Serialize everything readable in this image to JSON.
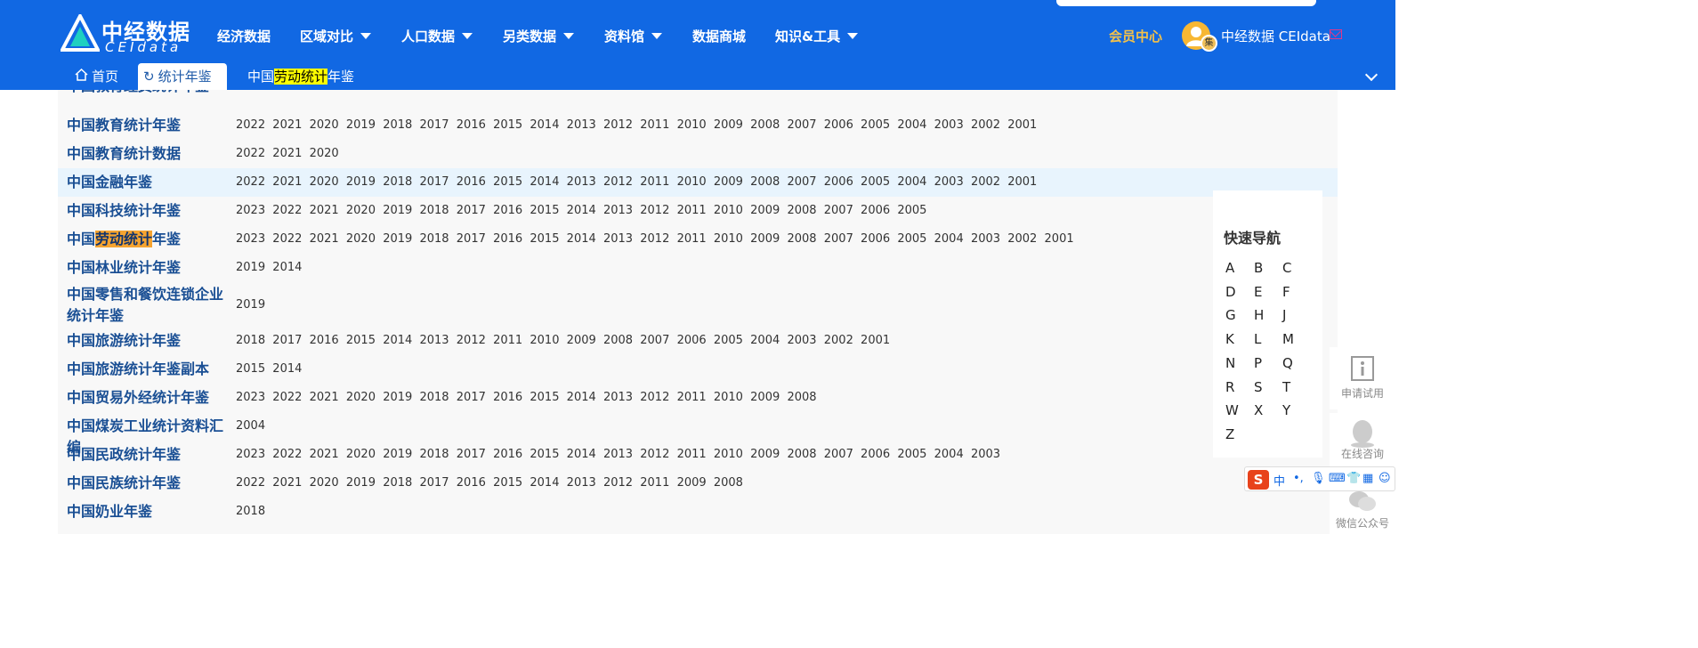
{
  "logo": {
    "cn": "中经数据",
    "en": "CEIdata"
  },
  "nav": [
    {
      "label": "经济数据",
      "dropdown": false
    },
    {
      "label": "区域对比",
      "dropdown": true
    },
    {
      "label": "人口数据",
      "dropdown": true
    },
    {
      "label": "另类数据",
      "dropdown": true
    },
    {
      "label": "资料馆",
      "dropdown": true
    },
    {
      "label": "数据商城",
      "dropdown": false
    },
    {
      "label": "知识&工具",
      "dropdown": true
    }
  ],
  "header": {
    "member_center": "会员中心",
    "avatar_badge": "集",
    "username": "中经数据 CEIdata"
  },
  "tabs": {
    "home": "首页",
    "yearbook": "统计年鉴",
    "current_pre": "中国",
    "current_hl": "劳动统计",
    "current_post": "年鉴"
  },
  "rows": [
    {
      "pre": "中国教育统计年鉴",
      "hl": "",
      "post": "",
      "years": [
        "2022",
        "2021",
        "2020",
        "2019",
        "2018",
        "2017",
        "2016",
        "2015",
        "2014",
        "2013",
        "2012",
        "2011",
        "2010",
        "2009",
        "2008",
        "2007",
        "2006",
        "2005",
        "2004",
        "2003",
        "2002",
        "2001"
      ]
    },
    {
      "pre": "中国教育统计数据",
      "hl": "",
      "post": "",
      "years": [
        "2022",
        "2021",
        "2020"
      ]
    },
    {
      "pre": "中国金融年鉴",
      "hl": "",
      "post": "",
      "highlight": true,
      "years": [
        "2022",
        "2021",
        "2020",
        "2019",
        "2018",
        "2017",
        "2016",
        "2015",
        "2014",
        "2013",
        "2012",
        "2011",
        "2010",
        "2009",
        "2008",
        "2007",
        "2006",
        "2005",
        "2004",
        "2003",
        "2002",
        "2001"
      ]
    },
    {
      "pre": "中国科技统计年鉴",
      "hl": "",
      "post": "",
      "years": [
        "2023",
        "2022",
        "2021",
        "2020",
        "2019",
        "2018",
        "2017",
        "2016",
        "2015",
        "2014",
        "2013",
        "2012",
        "2011",
        "2010",
        "2009",
        "2008",
        "2007",
        "2006",
        "2005"
      ]
    },
    {
      "pre": "中国",
      "hl": "劳动统计",
      "post": "年鉴",
      "years": [
        "2023",
        "2022",
        "2021",
        "2020",
        "2019",
        "2018",
        "2017",
        "2016",
        "2015",
        "2014",
        "2013",
        "2012",
        "2011",
        "2010",
        "2009",
        "2008",
        "2007",
        "2006",
        "2005",
        "2004",
        "2003",
        "2002",
        "2001"
      ]
    },
    {
      "pre": "中国林业统计年鉴",
      "hl": "",
      "post": "",
      "years": [
        "2019",
        "2014"
      ]
    },
    {
      "pre": "中国零售和餐饮连锁企业统计年鉴",
      "hl": "",
      "post": "",
      "tall": true,
      "years": [
        "2019"
      ]
    },
    {
      "pre": "中国旅游统计年鉴",
      "hl": "",
      "post": "",
      "years": [
        "2018",
        "2017",
        "2016",
        "2015",
        "2014",
        "2013",
        "2012",
        "2011",
        "2010",
        "2009",
        "2008",
        "2007",
        "2006",
        "2005",
        "2004",
        "2003",
        "2002",
        "2001"
      ]
    },
    {
      "pre": "中国旅游统计年鉴副本",
      "hl": "",
      "post": "",
      "years": [
        "2015",
        "2014"
      ]
    },
    {
      "pre": "中国贸易外经统计年鉴",
      "hl": "",
      "post": "",
      "years": [
        "2023",
        "2022",
        "2021",
        "2020",
        "2019",
        "2018",
        "2017",
        "2016",
        "2015",
        "2014",
        "2013",
        "2012",
        "2011",
        "2010",
        "2009",
        "2008"
      ]
    },
    {
      "pre": "中国煤炭工业统计资料汇编",
      "hl": "",
      "post": "",
      "years": [
        "2004"
      ]
    },
    {
      "pre": "中国民政统计年鉴",
      "hl": "",
      "post": "",
      "years": [
        "2023",
        "2022",
        "2021",
        "2020",
        "2019",
        "2018",
        "2017",
        "2016",
        "2015",
        "2014",
        "2013",
        "2012",
        "2011",
        "2010",
        "2009",
        "2008",
        "2007",
        "2006",
        "2005",
        "2004",
        "2003"
      ]
    },
    {
      "pre": "中国民族统计年鉴",
      "hl": "",
      "post": "",
      "years": [
        "2022",
        "2021",
        "2020",
        "2019",
        "2018",
        "2017",
        "2016",
        "2015",
        "2014",
        "2013",
        "2012",
        "2011",
        "2009",
        "2008"
      ]
    },
    {
      "pre": "中国奶业年鉴",
      "hl": "",
      "post": "",
      "years": [
        "2018"
      ]
    }
  ],
  "quick_nav": {
    "title": "快速导航",
    "letters": [
      "A",
      "B",
      "C",
      "D",
      "E",
      "F",
      "G",
      "H",
      "J",
      "K",
      "L",
      "M",
      "N",
      "P",
      "Q",
      "R",
      "S",
      "T",
      "W",
      "X",
      "Y",
      "Z"
    ]
  },
  "side_tools": {
    "trial": "申请试用",
    "consult": "在线咨询",
    "wechat": "微信公众号"
  },
  "ime": {
    "logo": "S",
    "mode": "中"
  }
}
